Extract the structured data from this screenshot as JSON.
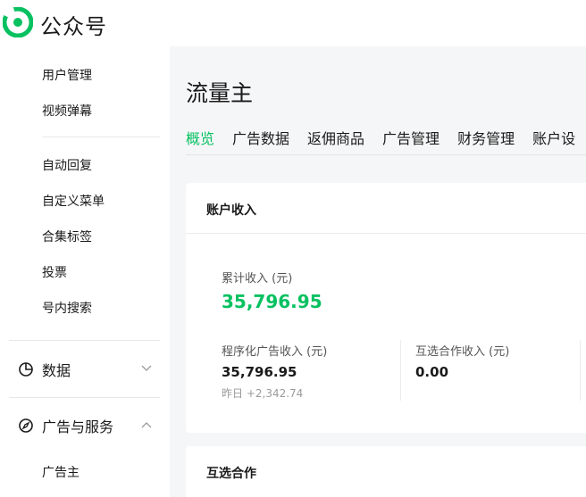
{
  "header": {
    "brand": "公众号",
    "logo_icon": "wechat-official-accounts-logo",
    "accent_color": "#07c160"
  },
  "sidebar": {
    "items_top": [
      {
        "label": "用户管理"
      },
      {
        "label": "视频弹幕"
      }
    ],
    "items_mid": [
      {
        "label": "自动回复"
      },
      {
        "label": "自定义菜单"
      },
      {
        "label": "合集标签"
      },
      {
        "label": "投票"
      },
      {
        "label": "号内搜索"
      }
    ],
    "groups": [
      {
        "label": "数据",
        "icon": "pie-chart-icon",
        "expanded": false
      },
      {
        "label": "广告与服务",
        "icon": "compass-icon",
        "expanded": true
      }
    ],
    "sub_items": [
      {
        "label": "广告主"
      }
    ]
  },
  "main": {
    "title": "流量主",
    "tabs": [
      {
        "label": "概览",
        "active": true
      },
      {
        "label": "广告数据",
        "active": false
      },
      {
        "label": "返佣商品",
        "active": false
      },
      {
        "label": "广告管理",
        "active": false
      },
      {
        "label": "财务管理",
        "active": false
      },
      {
        "label": "账户设",
        "active": false
      }
    ],
    "income_card": {
      "title": "账户收入",
      "cumulative_label": "累计收入 (元)",
      "cumulative_value": "35,796.95",
      "programmatic_label": "程序化广告收入 (元)",
      "programmatic_value": "35,796.95",
      "programmatic_delta": "昨日 +2,342.74",
      "mutual_label": "互选合作收入 (元)",
      "mutual_value": "0.00"
    },
    "mutual_card": {
      "title": "互选合作"
    }
  }
}
